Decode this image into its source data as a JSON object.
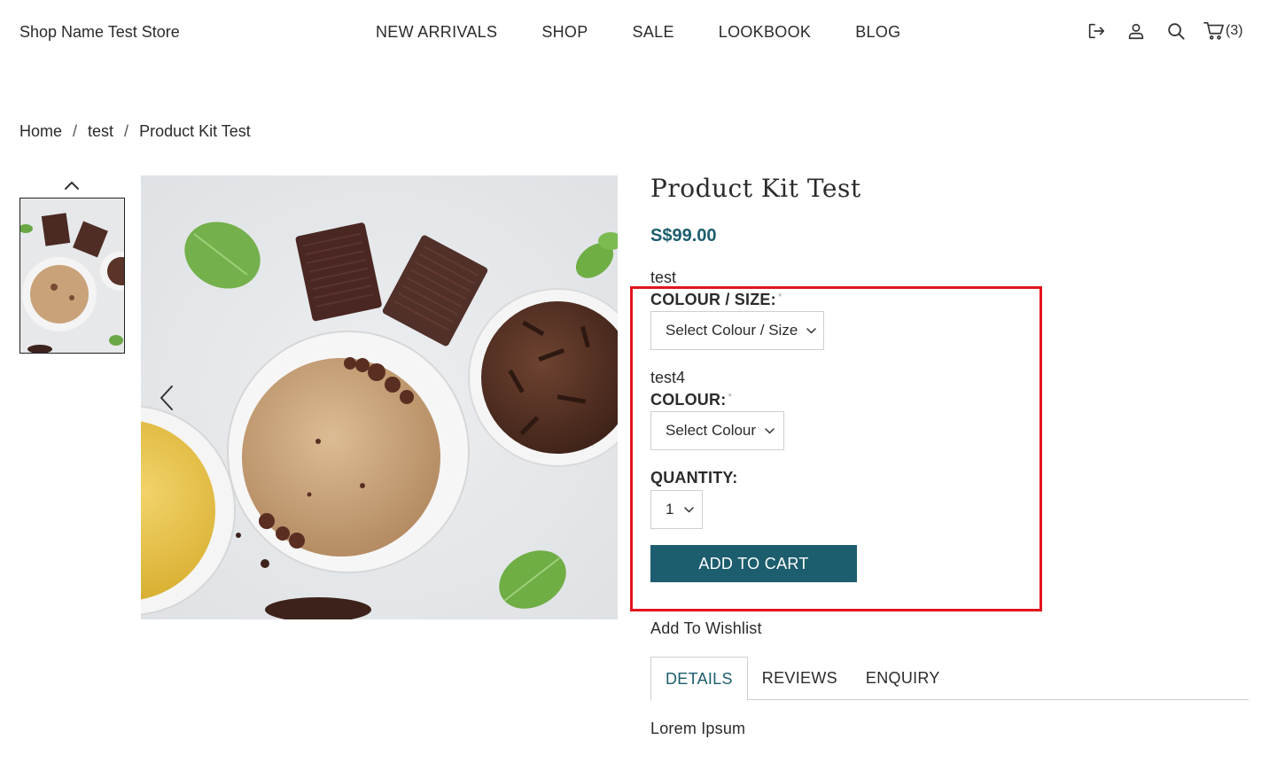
{
  "store": {
    "name": "Shop Name Test Store"
  },
  "nav": {
    "items": [
      {
        "label": "NEW ARRIVALS"
      },
      {
        "label": "SHOP"
      },
      {
        "label": "SALE"
      },
      {
        "label": "LOOKBOOK"
      },
      {
        "label": "BLOG"
      }
    ]
  },
  "header_icons": {
    "logout": "logout-icon",
    "account": "user-icon",
    "search": "search-icon",
    "cart": "cart-icon",
    "cart_count": "(3)"
  },
  "breadcrumb": {
    "items": [
      {
        "label": "Home"
      },
      {
        "label": "test"
      },
      {
        "label": "Product Kit Test"
      }
    ],
    "separator": "/"
  },
  "product": {
    "title": "Product Kit Test",
    "price": "S$99.00",
    "options": [
      {
        "group_name": "test",
        "label": "COLOUR / SIZE:",
        "required_mark": "*",
        "selected": "Select Colour / Size"
      },
      {
        "group_name": "test4",
        "label": "COLOUR:",
        "required_mark": "*",
        "selected": "Select Colour"
      }
    ],
    "quantity_label": "QUANTITY:",
    "quantity_value": "1",
    "add_to_cart_label": "ADD TO CART",
    "wishlist_label": "Add To Wishlist"
  },
  "tabs": {
    "items": [
      {
        "label": "DETAILS",
        "active": true
      },
      {
        "label": "REVIEWS",
        "active": false
      },
      {
        "label": "ENQUIRY",
        "active": false
      }
    ],
    "content": "Lorem Ipsum"
  },
  "colors": {
    "accent": "#1c5d6e",
    "highlight": "#e3141e"
  }
}
